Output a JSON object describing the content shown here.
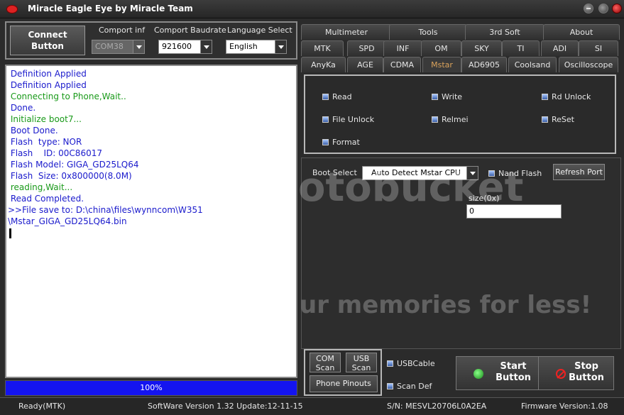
{
  "window": {
    "title": "Miracle Eagle Eye by Miracle Team"
  },
  "toolbar": {
    "connect_label": "Connect\nButton",
    "comport_label": "Comport inf",
    "comport_value": "COM38",
    "baudrate_label": "Comport Baudrate",
    "baudrate_value": "921600",
    "language_label": "Language Select",
    "language_value": "English"
  },
  "log": {
    "lines": [
      {
        "text": " Definition Applied",
        "color": "#1a1acc"
      },
      {
        "text": " Definition Applied",
        "color": "#1a1acc"
      },
      {
        "text": " Connecting to Phone,Wait..",
        "color": "#1a9a1a"
      },
      {
        "text": " Done.",
        "color": "#1a1acc"
      },
      {
        "text": " Initialize boot7...",
        "color": "#1a9a1a"
      },
      {
        "text": " Boot Done.",
        "color": "#1a1acc"
      },
      {
        "text": " Flash  type: NOR",
        "color": "#1a1acc"
      },
      {
        "text": " Flash    ID: 00C86017",
        "color": "#1a1acc"
      },
      {
        "text": " Flash Model: GIGA_GD25LQ64",
        "color": "#1a1acc"
      },
      {
        "text": " Flash  Size: 0x800000(8.0M)",
        "color": "#1a1acc"
      },
      {
        "text": " reading,Wait...",
        "color": "#1a9a1a"
      },
      {
        "text": " Read Completed.",
        "color": "#1a1acc"
      },
      {
        "text": ">>File save to: D:\\china\\files\\wynncom\\W351",
        "color": "#1a1acc"
      },
      {
        "text": "\\Mstar_GIGA_GD25LQ64.bin",
        "color": "#1a1acc"
      }
    ]
  },
  "progress": {
    "label": "100%",
    "percent": 100
  },
  "tabs": {
    "row1": [
      "Multimeter",
      "Tools",
      "3rd Soft",
      "About"
    ],
    "row2": [
      "MTK",
      "SPD",
      "INF",
      "OM",
      "SKY",
      "TI",
      "ADI",
      "SI"
    ],
    "row3": [
      "AnyKa",
      "AGE",
      "CDMA",
      "Mstar",
      "AD6905",
      "Coolsand",
      "Oscilloscope"
    ],
    "active": "Mstar"
  },
  "operations": {
    "read": "Read",
    "write": "Write",
    "rd_unlock": "Rd Unlock",
    "file_unlock": "File Unlock",
    "relmei": "Relmei",
    "reset": "ReSet",
    "format": "Format"
  },
  "boot": {
    "label": "Boot Select",
    "value": "Auto Detect Mstar CPU",
    "nand_flash": "Nand Flash",
    "refresh_port": "Refresh Port",
    "size_label": "size(0x)",
    "size_value": "0"
  },
  "watermark": {
    "brand": "otobucket",
    "tagline": "ur memories for less!"
  },
  "bottom": {
    "com_scan": "COM\nScan",
    "usb_scan": "USB\nScan",
    "phone_pinouts": "Phone Pinouts",
    "usb_cable": "USBCable",
    "scan_def": "Scan Def",
    "start": "Start\nButton",
    "stop": "Stop\nButton"
  },
  "status": {
    "state": "Ready(MTK)",
    "software": "SoftWare Version 1.32  Update:12-11-15",
    "serial": "S/N: MESVL20706L0A2EA",
    "firmware": "Firmware Version:1.08"
  }
}
